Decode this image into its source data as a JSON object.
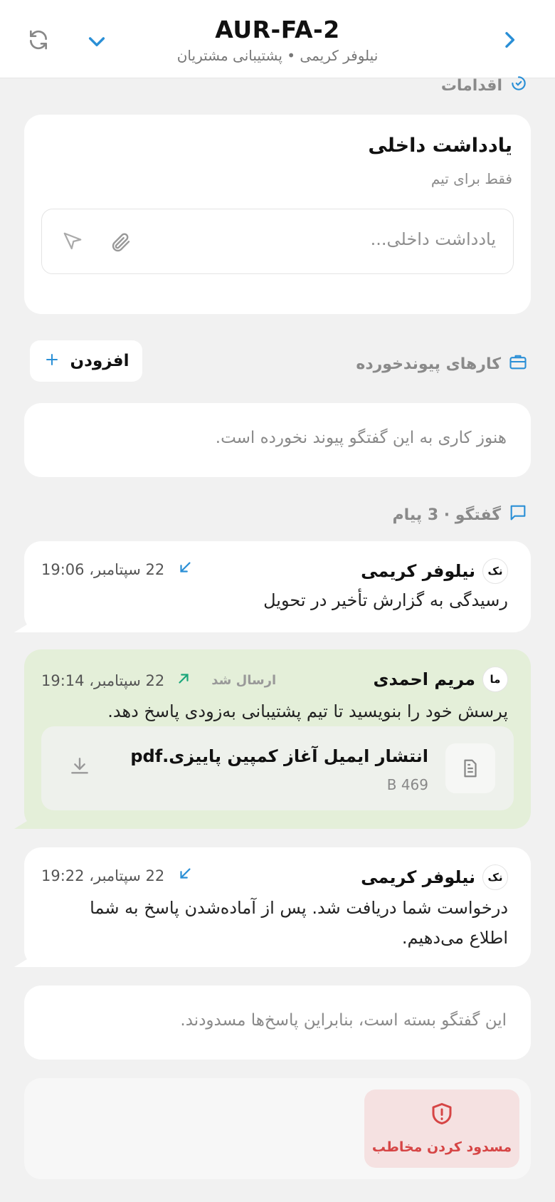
{
  "header": {
    "title": "AUR-FA-2",
    "subtitle": "نیلوفر کریمی • پشتیبانی مشتریان"
  },
  "actions_section": {
    "label": "اقدامات"
  },
  "internal_note": {
    "title": "یادداشت داخلی",
    "subtitle": "فقط برای تیم",
    "placeholder": "یادداشت داخلی..."
  },
  "linked_tasks": {
    "label": "کارهای پیوندخورده",
    "add_label": "افزودن",
    "empty_text": "هنوز کاری به این گفتگو پیوند نخورده است."
  },
  "conversation": {
    "label": "گفتگو · 3 پیام",
    "messages": [
      {
        "initials": "نک",
        "name": "نیلوفر کریمی",
        "time": "22 سپتامبر، 19:06",
        "direction": "incoming",
        "text": "رسیدگی به گزارش تأخیر در تحویل"
      },
      {
        "initials": "ما",
        "name": "مریم احمدی",
        "status": "ارسال شد",
        "time": "22 سپتامبر، 19:14",
        "direction": "outgoing",
        "text": "پرسش خود را بنویسید تا تیم پشتیبانی به‌زودی پاسخ دهد.",
        "attachment": {
          "name": "انتشار ایمیل آغاز کمپین پاییزی.pdf",
          "size": "469 B"
        }
      },
      {
        "initials": "نک",
        "name": "نیلوفر کریمی",
        "time": "22 سپتامبر، 19:22",
        "direction": "incoming",
        "text": "درخواست شما دریافت شد. پس از آماده‌شدن پاسخ به شما اطلاع می‌دهیم."
      }
    ]
  },
  "closed_notice": "این گفتگو بسته است، بنابراین پاسخ‌ها مسدودند.",
  "block_button": {
    "label": "مسدود کردن مخاطب"
  },
  "colors": {
    "accent": "#2a8fd6",
    "outgoing_bubble": "#e4efd9",
    "danger": "#d64545",
    "danger_bg": "#f5e1e1",
    "sent_arrow": "#1aa67a"
  }
}
